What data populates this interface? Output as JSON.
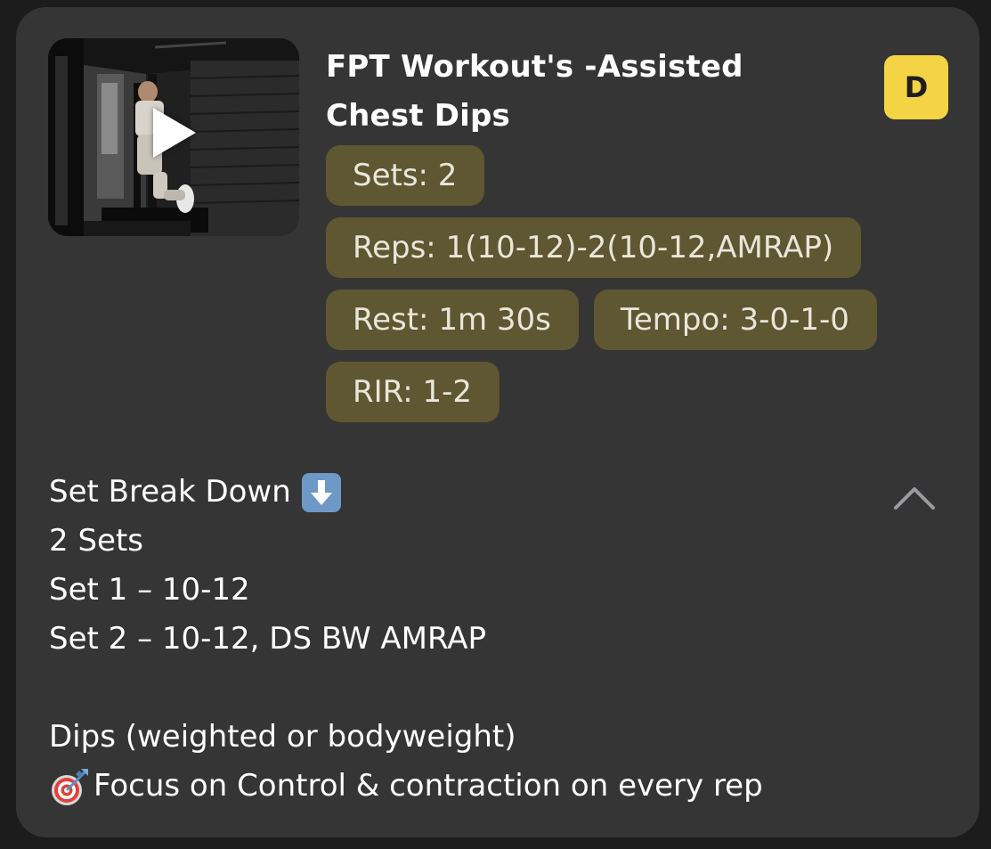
{
  "exercise": {
    "title_line1": "FPT Workout's -Assisted",
    "title_line2": "Chest Dips",
    "badge": "D",
    "thumbnail_icon": "play-icon"
  },
  "chips": {
    "sets": "Sets: 2",
    "reps": "Reps: 1(10-12)-2(10-12,AMRAP)",
    "rest": "Rest: 1m 30s",
    "tempo": "Tempo: 3-0-1-0",
    "rir": "RIR: 1-2"
  },
  "description": {
    "heading": "Set Break Down",
    "heading_icon": "down-arrow-emoji-icon",
    "line2": "2 Sets",
    "line3": "Set 1 – 10-12",
    "line4": "Set 2 – 10-12, DS BW AMRAP",
    "line6": "Dips (weighted or bodyweight)",
    "line7": "Focus on Control & contraction on every rep",
    "line7_icon": "target-emoji-icon"
  },
  "controls": {
    "collapse_icon": "chevron-up-icon"
  },
  "colors": {
    "card_bg": "#353535",
    "chip_bg": "#5f5632",
    "badge_bg": "#f4d444",
    "chevron": "#9a9aa0"
  }
}
